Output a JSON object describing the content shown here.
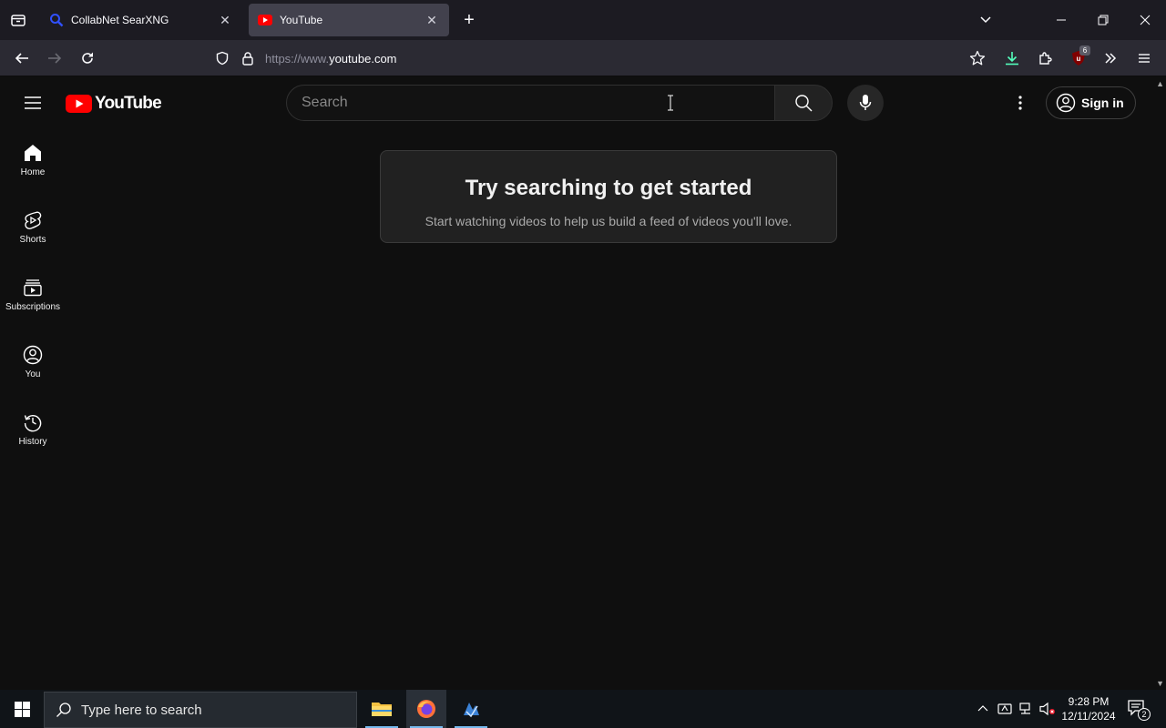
{
  "browser": {
    "tabs": [
      {
        "title": "CollabNet SearXNG",
        "close": "✕"
      },
      {
        "title": "YouTube",
        "close": "✕"
      }
    ],
    "new_tab": "+",
    "url_prefix": "https://www.",
    "url_host": "youtube.com",
    "extension_badge": "6"
  },
  "youtube": {
    "logo_text": "YouTube",
    "search_placeholder": "Search",
    "sign_in": "Sign in",
    "guide": [
      {
        "label": "Home",
        "icon": "home-icon"
      },
      {
        "label": "Shorts",
        "icon": "shorts-icon"
      },
      {
        "label": "Subscriptions",
        "icon": "subscriptions-icon"
      },
      {
        "label": "You",
        "icon": "you-icon"
      },
      {
        "label": "History",
        "icon": "history-icon"
      }
    ],
    "prompt": {
      "title": "Try searching to get started",
      "subtitle": "Start watching videos to help us build a feed of videos you'll love."
    },
    "brand_red": "#ff0000"
  },
  "taskbar": {
    "search_placeholder": "Type here to search",
    "time": "9:28 PM",
    "date": "12/11/2024",
    "notification_count": "2"
  }
}
